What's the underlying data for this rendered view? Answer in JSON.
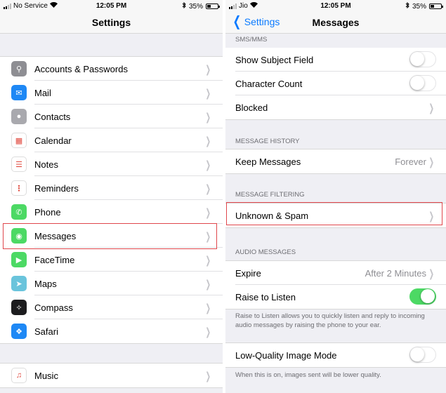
{
  "left": {
    "status": {
      "carrier": "No Service",
      "time": "12:05 PM",
      "battery": "35%",
      "battery_level": 0.35
    },
    "nav_title": "Settings",
    "items_group1": [
      {
        "label": "Accounts & Passwords",
        "icon": "key-icon",
        "color": "#8e8e93"
      },
      {
        "label": "Mail",
        "icon": "mail-icon",
        "color": "#1e88f5"
      },
      {
        "label": "Contacts",
        "icon": "contacts-icon",
        "color": "#a9a9ae"
      },
      {
        "label": "Calendar",
        "icon": "calendar-icon",
        "color": "#ffffff"
      },
      {
        "label": "Notes",
        "icon": "notes-icon",
        "color": "#ffffff"
      },
      {
        "label": "Reminders",
        "icon": "reminders-icon",
        "color": "#ffffff"
      },
      {
        "label": "Phone",
        "icon": "phone-icon",
        "color": "#4cd964"
      },
      {
        "label": "Messages",
        "icon": "messages-icon",
        "color": "#4cd964"
      },
      {
        "label": "FaceTime",
        "icon": "facetime-icon",
        "color": "#4cd964"
      },
      {
        "label": "Maps",
        "icon": "maps-icon",
        "color": "#6ac4dc"
      },
      {
        "label": "Compass",
        "icon": "compass-icon",
        "color": "#1c1c1e"
      },
      {
        "label": "Safari",
        "icon": "safari-icon",
        "color": "#1e88f5"
      }
    ],
    "items_group2": [
      {
        "label": "Music",
        "icon": "music-icon",
        "color": "#ffffff"
      }
    ]
  },
  "right": {
    "status": {
      "carrier": "Jio",
      "time": "12:05 PM",
      "battery": "35%",
      "battery_level": 0.35
    },
    "back_label": "Settings",
    "nav_title": "Messages",
    "sms_header": "SMS/MMS",
    "show_subject": {
      "label": "Show Subject Field",
      "on": false
    },
    "character_count": {
      "label": "Character Count",
      "on": false
    },
    "blocked_label": "Blocked",
    "history_header": "MESSAGE HISTORY",
    "keep_messages": {
      "label": "Keep Messages",
      "value": "Forever"
    },
    "filtering_header": "MESSAGE FILTERING",
    "unknown_spam_label": "Unknown & Spam",
    "audio_header": "AUDIO MESSAGES",
    "expire": {
      "label": "Expire",
      "value": "After 2 Minutes"
    },
    "raise_to_listen": {
      "label": "Raise to Listen",
      "on": true
    },
    "raise_note": "Raise to Listen allows you to quickly listen and reply to incoming audio messages by raising the phone to your ear.",
    "low_quality": {
      "label": "Low-Quality Image Mode",
      "on": false
    },
    "low_quality_note": "When this is on, images sent will be lower quality."
  },
  "colors": {
    "accent": "#0a7aff",
    "toggle_on": "#4cd964",
    "highlight": "#e0474c"
  }
}
